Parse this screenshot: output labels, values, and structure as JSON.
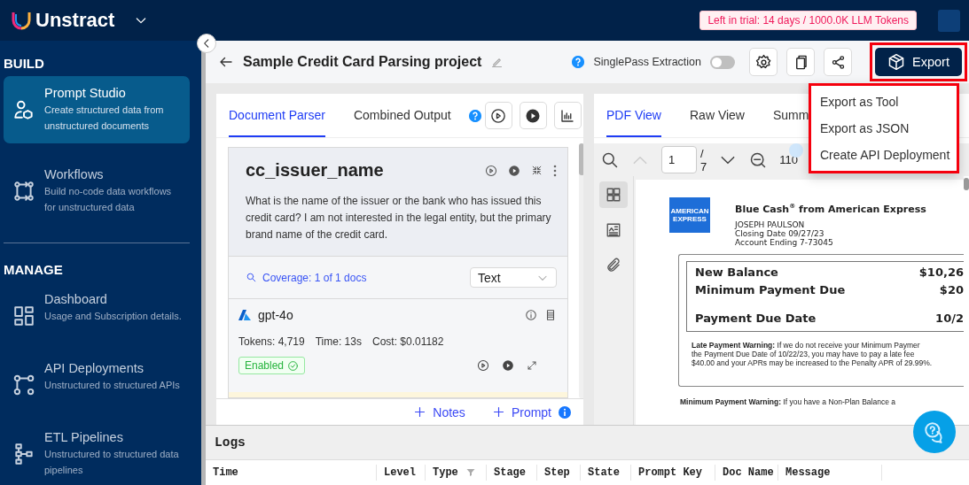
{
  "header": {
    "logo": "Unstract",
    "trial_badge": "Left in trial: 14 days / 1000.0K LLM Tokens"
  },
  "sidebar": {
    "sections": [
      {
        "title": "BUILD",
        "items": [
          {
            "kind": "prompt",
            "title": "Prompt Studio",
            "description": "Create structured data from unstructured documents",
            "selected": true
          },
          {
            "kind": "workflow",
            "title": "Workflows",
            "description": "Build no-code data workflows for unstructured data",
            "selected": false
          }
        ]
      },
      {
        "title": "MANAGE",
        "items": [
          {
            "kind": "dashboard",
            "title": "Dashboard",
            "description": "Usage and Subscription details.",
            "selected": false
          },
          {
            "kind": "api",
            "title": "API Deployments",
            "description": "Unstructured to structured APIs",
            "selected": false
          },
          {
            "kind": "etl",
            "title": "ETL Pipelines",
            "description": "Unstructured to structured data pipelines",
            "selected": false
          }
        ]
      }
    ]
  },
  "topbar": {
    "title": "Sample Credit Card Parsing project",
    "singlepass": {
      "label": "SinglePass Extraction",
      "on": false
    },
    "export_button": "Export",
    "export_menu": [
      "Export as Tool",
      "Export as JSON",
      "Create API Deployment"
    ]
  },
  "left_panel": {
    "tabs": [
      {
        "label": "Document Parser",
        "selected": true
      },
      {
        "label": "Combined Output",
        "selected": false
      }
    ],
    "prompt_card": {
      "key": "cc_issuer_name",
      "prompt": "What is the name of the issuer or the bank who has issued this credit card? I am not interested in the legal entity, but the primary brand name of the credit card.",
      "coverage": "Coverage: 1 of 1 docs",
      "output_type": "Text",
      "llm": {
        "name": "gpt-4o",
        "tokens": "Tokens: 4,719",
        "time": "Time: 13s",
        "cost": "Cost: $0.01182",
        "status": "Enabled"
      }
    },
    "footer": [
      "Notes",
      "Prompt"
    ]
  },
  "right_panel": {
    "tabs": [
      {
        "label": "PDF View",
        "selected": true
      },
      {
        "label": "Raw View",
        "selected": false
      },
      {
        "label": "Summ",
        "selected": false
      }
    ],
    "page": "1",
    "page_sep": "/",
    "page_total": "7",
    "zoom": "110",
    "document": {
      "logo_text": [
        "AMERICAN",
        "EXPRESS"
      ],
      "product": "Blue Cash$^{®}$ from American Express",
      "holder": "JOSEPH PAULSON",
      "closing": "Closing Date 09/27/23",
      "account": "Account Ending 7-73045",
      "summary": [
        {
          "label": "New Balance",
          "value": "$10,26"
        },
        {
          "label": "Minimum Payment Due",
          "value": "$20"
        },
        {
          "label": "Payment Due Date",
          "value": "10/2"
        }
      ],
      "late_warning": "**Late Payment Warning:** If we do not receive your Minimum Paymer the Payment Due Date of 10/22/23, you may have to pay a late fee $40.00 and your APRs may be increased to the Penalty APR of 29.99%.",
      "min_warning": "**Minimum Payment Warning:** If you have a Non-Plan Balance a"
    }
  },
  "logs": {
    "title": "Logs",
    "columns": [
      "Time",
      "Level",
      "Type",
      "Stage",
      "Step",
      "State",
      "Prompt Key",
      "Doc Name",
      "Message"
    ]
  }
}
